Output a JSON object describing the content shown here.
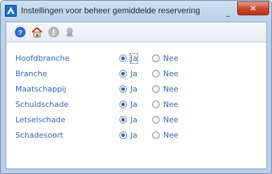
{
  "window": {
    "title": "Instellingen voor beheer gemiddelde reservering",
    "minimize_glyph": "_",
    "close_glyph": "✕"
  },
  "toolbar": {
    "icons": [
      "help-icon",
      "home-icon",
      "info-icon",
      "user-ribbon-icon"
    ]
  },
  "options": {
    "yes_label": "Ja",
    "no_label": "Nee"
  },
  "settings": [
    {
      "label": "Hoofdbranche",
      "value": "Ja"
    },
    {
      "label": "Branche",
      "value": "Ja"
    },
    {
      "label": "Maatschappij",
      "value": "Ja"
    },
    {
      "label": "Schuldschade",
      "value": "Ja"
    },
    {
      "label": "Letselschade",
      "value": "Ja"
    },
    {
      "label": "Schadesoort",
      "value": "Ja"
    }
  ],
  "colors": {
    "label_blue": "#2e66b0",
    "radio_selected": "#1f63b3",
    "close_red": "#c9492f"
  }
}
